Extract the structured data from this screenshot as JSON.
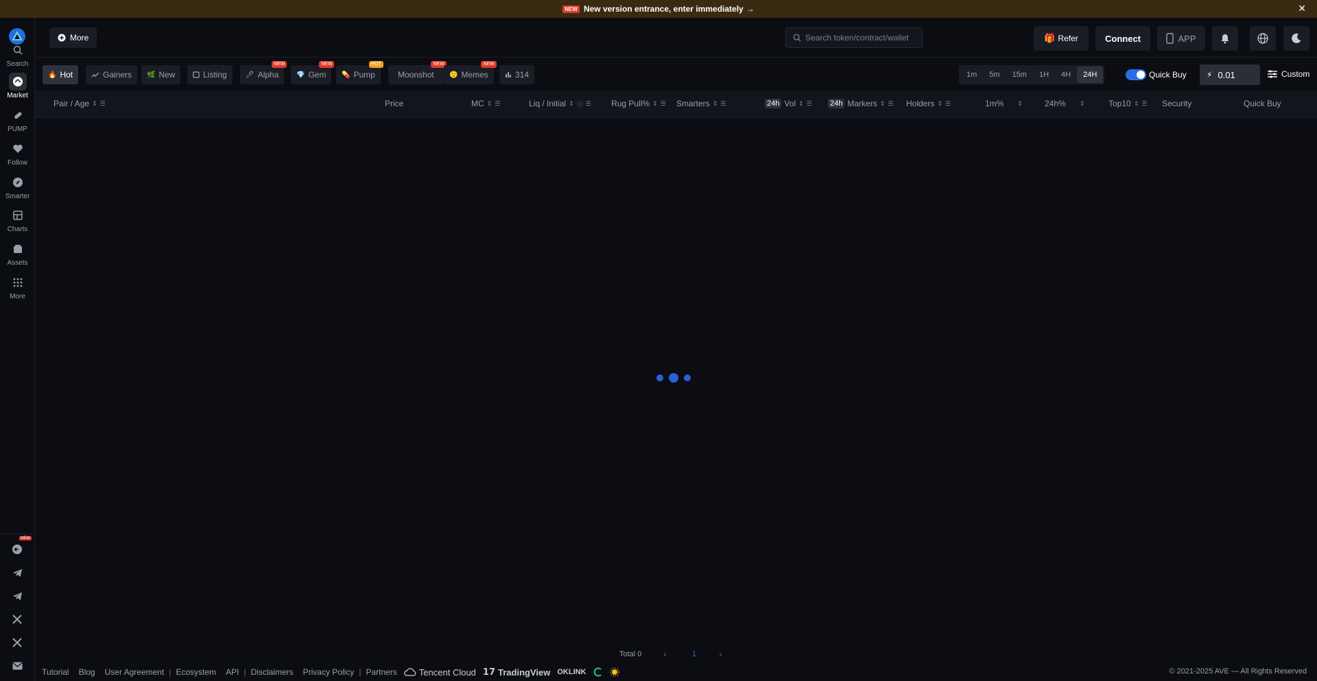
{
  "banner": {
    "tag": "NEW",
    "text": "New version entrance, enter immediately",
    "arrow": "→",
    "close": "✕"
  },
  "sidebar": {
    "items": [
      {
        "label": "Search",
        "icon": "search-icon"
      },
      {
        "label": "Market",
        "icon": "market-icon",
        "active": true
      },
      {
        "label": "PUMP",
        "icon": "pill-icon"
      },
      {
        "label": "Follow",
        "icon": "heart-icon"
      },
      {
        "label": "Smarter",
        "icon": "compass-icon"
      },
      {
        "label": "Charts",
        "icon": "chart-icon"
      },
      {
        "label": "Assets",
        "icon": "wallet-icon"
      },
      {
        "label": "More",
        "icon": "grid-icon"
      }
    ],
    "social_new_tag": "NEW"
  },
  "topbar": {
    "more_label": "More",
    "search_placeholder": "Search token/contract/wallet",
    "refer_label": "Refer",
    "connect_label": "Connect",
    "app_label": "APP"
  },
  "tabs": [
    {
      "label": "Hot",
      "active": true
    },
    {
      "label": "Gainers"
    },
    {
      "label": "New"
    },
    {
      "label": "Listing"
    },
    {
      "label": "Alpha",
      "badge": "NEW"
    },
    {
      "label": "Gem",
      "badge": "NEW"
    },
    {
      "label": "Pump",
      "badge": "HOT"
    },
    {
      "label": "Moonshot",
      "badge": "NEW"
    },
    {
      "label": "Memes",
      "badge": "NEW"
    },
    {
      "label": "314"
    }
  ],
  "timeframes": [
    "1m",
    "5m",
    "15m",
    "1H",
    "4H",
    "24H"
  ],
  "timeframe_active": "24H",
  "quick_buy": {
    "label": "Quick Buy",
    "amount": "0.01",
    "enabled": true
  },
  "custom_label": "Custom",
  "table": {
    "columns": {
      "pair": "Pair / Age",
      "price": "Price",
      "mc": "MC",
      "liq": "Liq / Initial",
      "rug": "Rug Pull%",
      "smarters": "Smarters",
      "vol_pill": "24h",
      "vol": "Vol",
      "markers_pill": "24h",
      "markers": "Markers",
      "holders": "Holders",
      "m1": "1m%",
      "h24": "24h%",
      "top10": "Top10",
      "security": "Security",
      "quickbuy": "Quick Buy"
    }
  },
  "pagination": {
    "total": "Total 0",
    "page": "1",
    "prev": "‹",
    "next": "›"
  },
  "footer": {
    "links": [
      "Tutorial",
      "Blog",
      "User Agreement",
      "Ecosystem",
      "API",
      "Disclaimers",
      "Privacy Policy",
      "Partners"
    ],
    "brands": [
      "Tencent Cloud",
      "TradingView",
      "OKLINK"
    ],
    "copyright": "© 2021-2025 AVE — All Rights Reserved"
  },
  "colors": {
    "accent": "#2b6de8",
    "banner_bg": "#3b2a12",
    "new_badge": "#e0392b",
    "hot_badge": "#f0a020"
  }
}
